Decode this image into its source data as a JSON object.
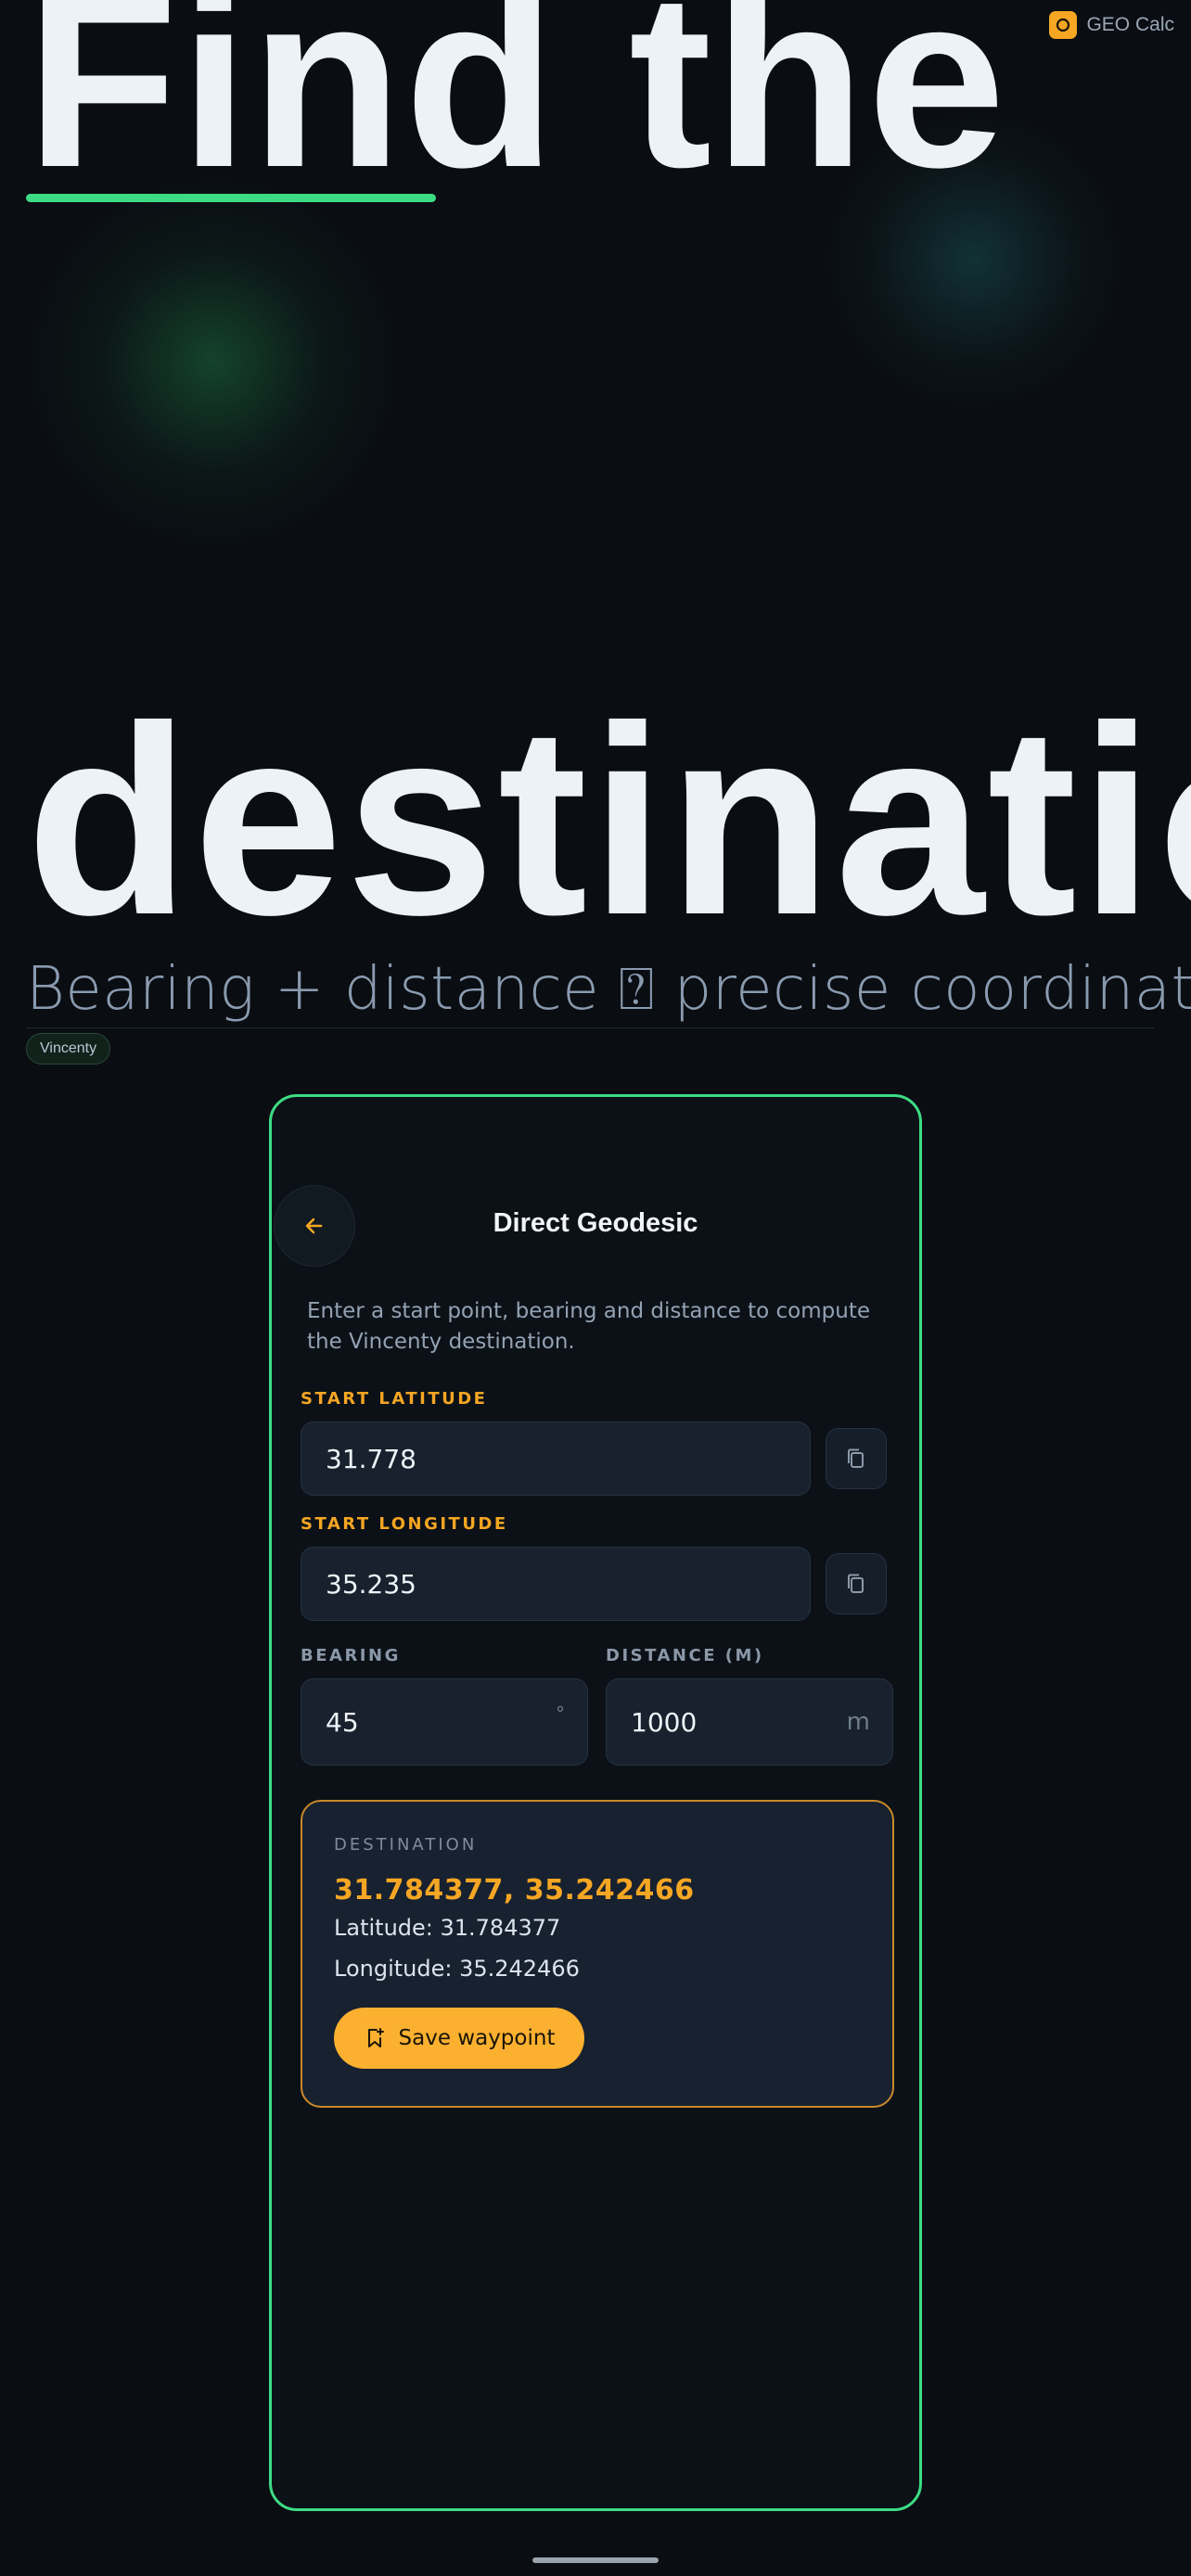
{
  "app": {
    "name": "GEO Calc",
    "logo_icon": "circle-logo-icon",
    "accent": "#f5a623"
  },
  "hero": {
    "line1": "Find the",
    "line2": "destinatio",
    "subtitle": "Bearing + distance ⍰ precise coordinate",
    "chip": "Vincenty"
  },
  "screen": {
    "back_icon": "arrow-left-icon",
    "title": "Direct Geodesic",
    "description": "Enter a start point, bearing and distance to compute the Vincenty destination.",
    "fields": {
      "start_latitude": {
        "label": "START LATITUDE",
        "value": "31.778"
      },
      "start_longitude": {
        "label": "START LONGITUDE",
        "value": "35.235"
      },
      "bearing": {
        "label": "BEARING",
        "value": "45",
        "unit": "°"
      },
      "distance": {
        "label": "DISTANCE (M)",
        "value": "1000",
        "unit": "m"
      }
    },
    "result": {
      "label": "DESTINATION",
      "coords": "31.784377, 35.242466",
      "latitude_line": "Latitude: 31.784377",
      "longitude_line": "Longitude: 35.242466",
      "save_label": "Save waypoint"
    }
  },
  "colors": {
    "frame": "#3ddc84",
    "result_border": "#c9892a",
    "button": "#fbb030"
  }
}
